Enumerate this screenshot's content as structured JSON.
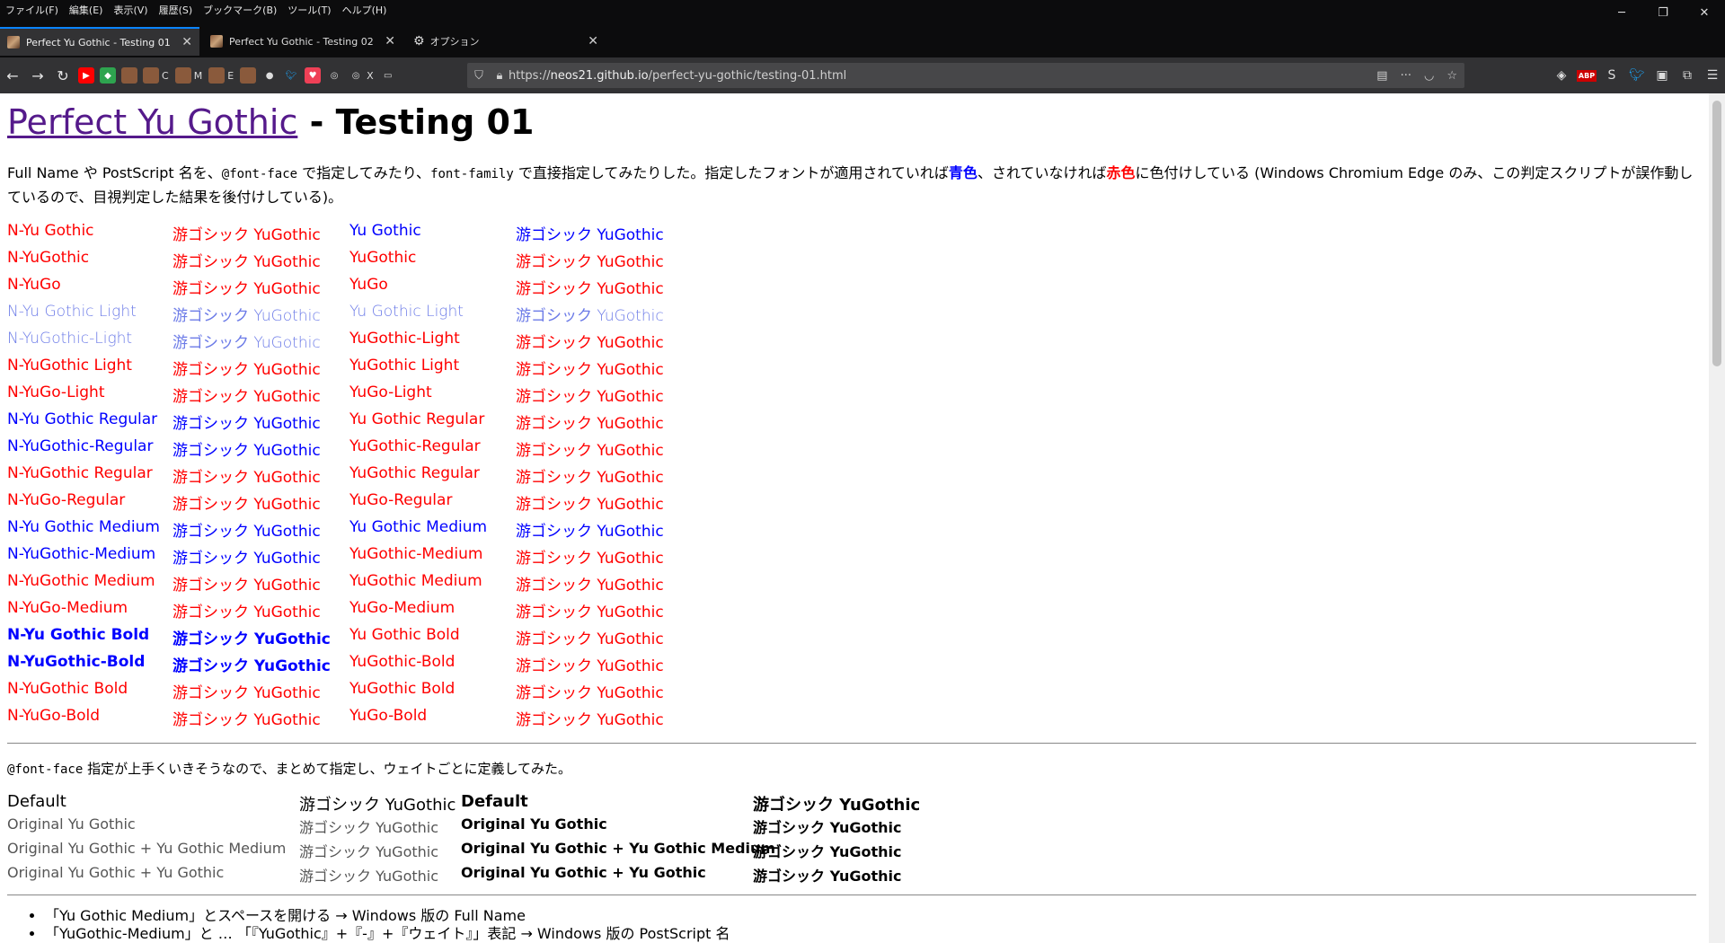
{
  "menu": [
    "ファイル(F)",
    "編集(E)",
    "表示(V)",
    "履歴(S)",
    "ブックマーク(B)",
    "ツール(T)",
    "ヘルプ(H)"
  ],
  "tabs": [
    {
      "label": "Perfect Yu Gothic - Testing 01"
    },
    {
      "label": "Perfect Yu Gothic - Testing 02"
    },
    {
      "label": "オプション"
    }
  ],
  "bookmarks": [
    "C",
    "M",
    "E",
    "X"
  ],
  "url": {
    "prefix": "https://",
    "host": "neos21.github.io",
    "path": "/perfect-yu-gothic/testing-01.html"
  },
  "page": {
    "title_link": "Perfect Yu Gothic",
    "title_suffix": " - Testing 01",
    "intro": {
      "p1": "Full Name や PostScript 名を、",
      "code1": "@font-face",
      "p2": " で指定してみたり、",
      "code2": "font-family",
      "p3": " で直接指定してみたりした。指定したフォントが適用されていれば",
      "blue": "青色",
      "p4": "、されていなければ",
      "red": "赤色",
      "p5": "に色付けしている (Windows Chromium Edge のみ、この判定スクリプトが誤作動しているので、目視判定した結果を後付けしている)。"
    },
    "jp_sample": "游ゴシック YuGothic",
    "rows": [
      {
        "n": "N-Yu Gothic",
        "nc": "R",
        "a": "R",
        "f": "Yu Gothic",
        "fc": "B",
        "b": "B"
      },
      {
        "n": "N-YuGothic",
        "nc": "R",
        "a": "R",
        "f": "YuGothic",
        "fc": "R",
        "b": "R"
      },
      {
        "n": "N-YuGo",
        "nc": "R",
        "a": "R",
        "f": "YuGo",
        "fc": "R",
        "b": "R"
      },
      {
        "n": "N-Yu Gothic Light",
        "nc": "L",
        "a": "L",
        "f": "Yu Gothic Light",
        "fc": "L",
        "b": "L"
      },
      {
        "n": "N-YuGothic-Light",
        "nc": "L",
        "a": "L",
        "f": "YuGothic-Light",
        "fc": "R",
        "b": "R"
      },
      {
        "n": "N-YuGothic Light",
        "nc": "R",
        "a": "R",
        "f": "YuGothic Light",
        "fc": "R",
        "b": "R"
      },
      {
        "n": "N-YuGo-Light",
        "nc": "R",
        "a": "R",
        "f": "YuGo-Light",
        "fc": "R",
        "b": "R"
      },
      {
        "n": "N-Yu Gothic Regular",
        "nc": "B",
        "a": "B",
        "f": "Yu Gothic Regular",
        "fc": "R",
        "b": "R"
      },
      {
        "n": "N-YuGothic-Regular",
        "nc": "B",
        "a": "B",
        "f": "YuGothic-Regular",
        "fc": "R",
        "b": "R"
      },
      {
        "n": "N-YuGothic Regular",
        "nc": "R",
        "a": "R",
        "f": "YuGothic Regular",
        "fc": "R",
        "b": "R"
      },
      {
        "n": "N-YuGo-Regular",
        "nc": "R",
        "a": "R",
        "f": "YuGo-Regular",
        "fc": "R",
        "b": "R"
      },
      {
        "n": "N-Yu Gothic Medium",
        "nc": "B",
        "a": "B",
        "f": "Yu Gothic Medium",
        "fc": "B",
        "b": "B"
      },
      {
        "n": "N-YuGothic-Medium",
        "nc": "B",
        "a": "B",
        "f": "YuGothic-Medium",
        "fc": "R",
        "b": "R"
      },
      {
        "n": "N-YuGothic Medium",
        "nc": "R",
        "a": "R",
        "f": "YuGothic Medium",
        "fc": "R",
        "b": "R"
      },
      {
        "n": "N-YuGo-Medium",
        "nc": "R",
        "a": "R",
        "f": "YuGo-Medium",
        "fc": "R",
        "b": "R"
      },
      {
        "n": "N-Yu Gothic Bold",
        "nc": "Bb",
        "a": "Bb",
        "f": "Yu Gothic Bold",
        "fc": "R",
        "b": "R"
      },
      {
        "n": "N-YuGothic-Bold",
        "nc": "Bb",
        "a": "Bb",
        "f": "YuGothic-Bold",
        "fc": "R",
        "b": "R"
      },
      {
        "n": "N-YuGothic Bold",
        "nc": "R",
        "a": "R",
        "f": "YuGothic Bold",
        "fc": "R",
        "b": "R"
      },
      {
        "n": "N-YuGo-Bold",
        "nc": "R",
        "a": "R",
        "f": "YuGo-Bold",
        "fc": "R",
        "b": "R"
      }
    ],
    "note2_code": "@font-face",
    "note2_text": " 指定が上手くいきそうなので、まとめて指定し、ウェイトごとに定義してみた。",
    "table2": [
      [
        "Default",
        "游ゴシック YuGothic",
        "Default",
        "游ゴシック YuGothic"
      ],
      [
        "Original Yu Gothic",
        "游ゴシック YuGothic",
        "Original Yu Gothic",
        "游ゴシック YuGothic"
      ],
      [
        "Original Yu Gothic + Yu Gothic Medium",
        "游ゴシック YuGothic",
        "Original Yu Gothic + Yu Gothic Medium",
        "游ゴシック YuGothic"
      ],
      [
        "Original Yu Gothic + Yu Gothic",
        "游ゴシック YuGothic",
        "Original Yu Gothic + Yu Gothic",
        "游ゴシック YuGothic"
      ]
    ],
    "bullets": [
      "「Yu Gothic Medium」とスペースを開ける → Windows 版の Full Name",
      "「YuGothic-Medium」と … 「『YuGothic』+『-』+『ウェイト』」表記 → Windows 版の PostScript 名"
    ]
  }
}
